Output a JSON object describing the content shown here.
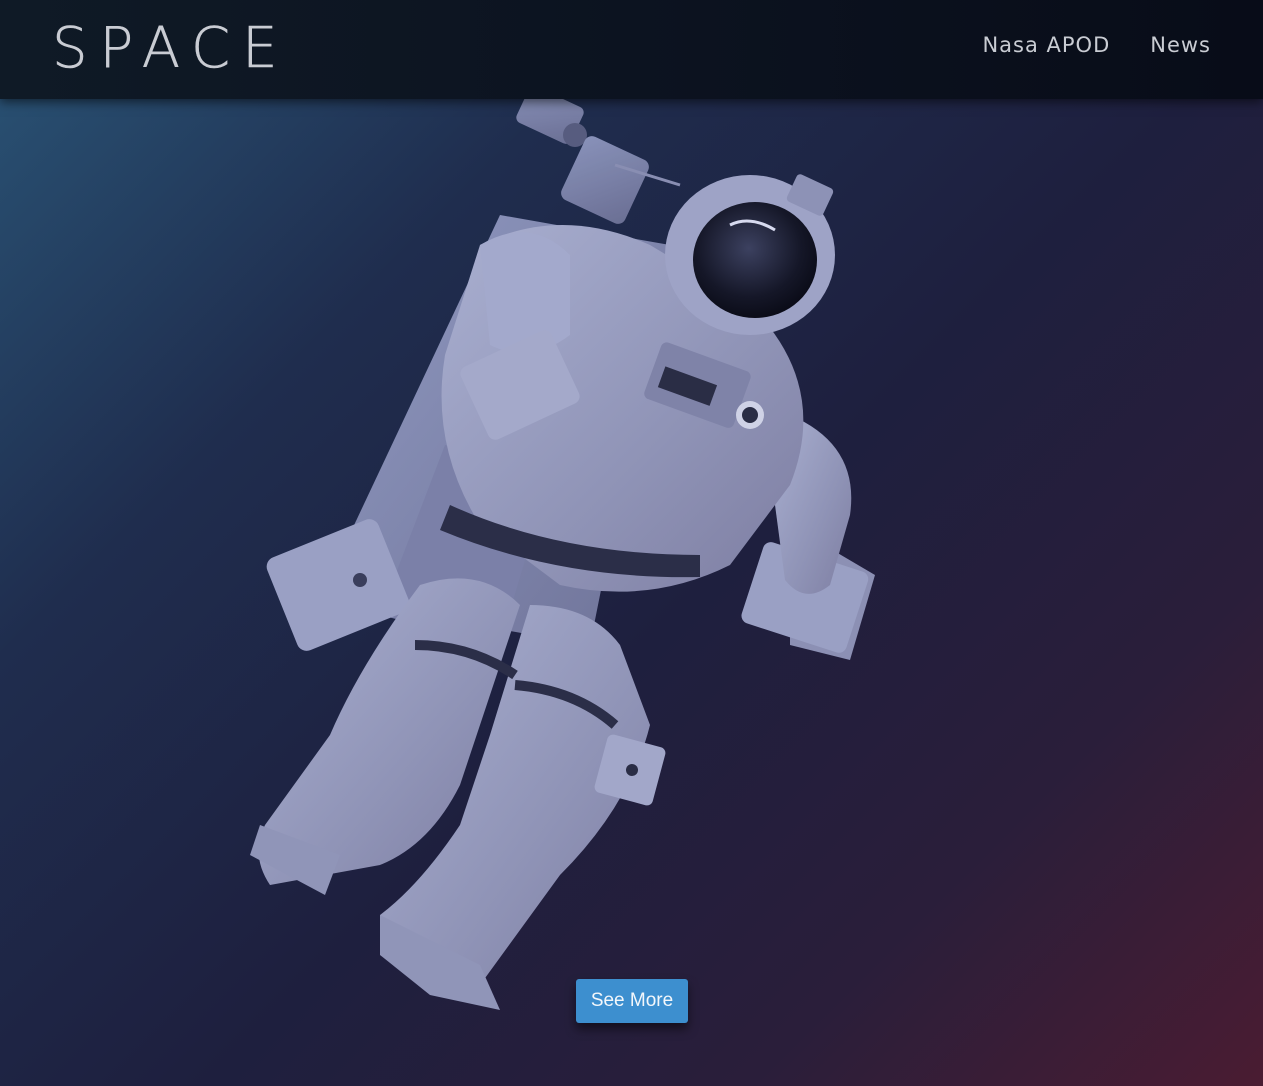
{
  "header": {
    "logo_text": "SPACE",
    "nav": [
      {
        "label": "Nasa APOD"
      },
      {
        "label": "News"
      }
    ]
  },
  "hero": {
    "image_subject": "astronaut-illustration",
    "cta_label": "See More"
  },
  "colors": {
    "navbar_bg": "#0c1320",
    "text_light": "#c9ccd3",
    "cta_bg": "#3d8fcf",
    "suit": "#9a9fc2"
  }
}
